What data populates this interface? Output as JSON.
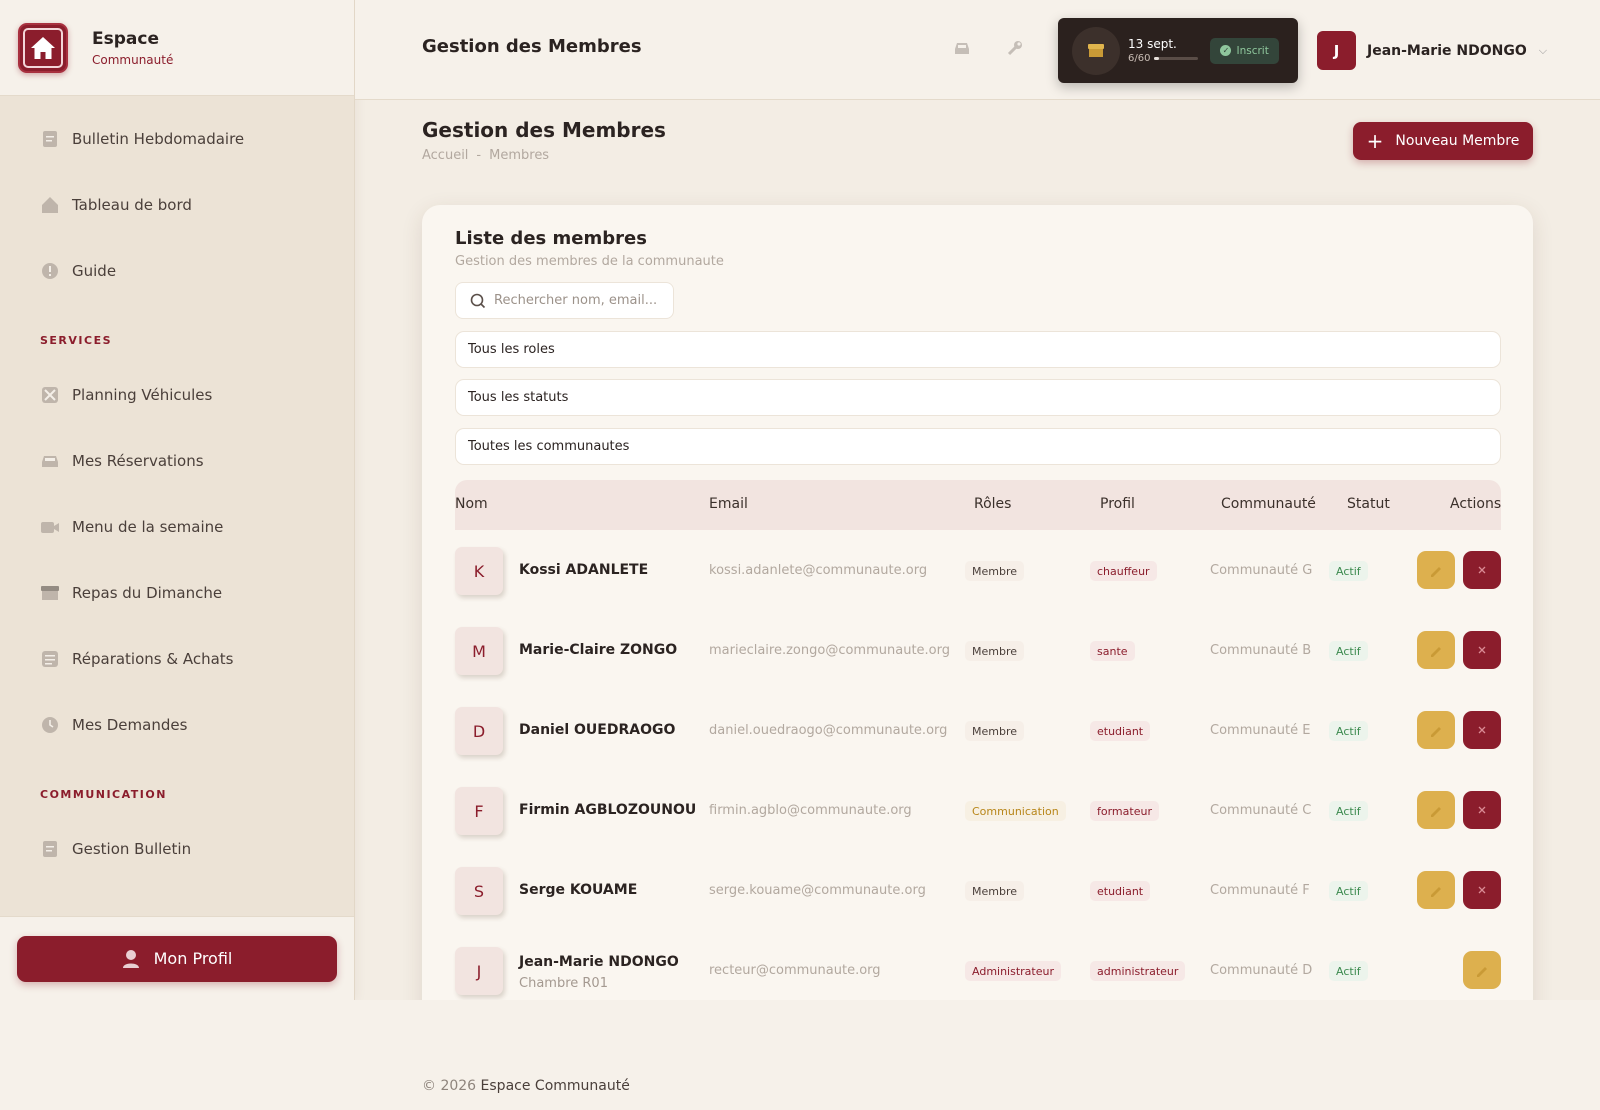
{
  "brand": {
    "title": "Espace",
    "subtitle": "Communauté"
  },
  "sidebar": {
    "items_top": [
      {
        "label": "Bulletin Hebdomadaire",
        "icon": "document-icon"
      },
      {
        "label": "Tableau de bord",
        "icon": "home-icon"
      },
      {
        "label": "Guide",
        "icon": "info-icon"
      }
    ],
    "section_services": "SERVICES",
    "items_services": [
      {
        "label": "Planning Véhicules",
        "icon": "tools-icon"
      },
      {
        "label": "Mes Réservations",
        "icon": "car-icon"
      },
      {
        "label": "Menu de la semaine",
        "icon": "video-icon"
      },
      {
        "label": "Repas du Dimanche",
        "icon": "box-icon"
      },
      {
        "label": "Réparations & Achats",
        "icon": "checklist-icon"
      },
      {
        "label": "Mes Demandes",
        "icon": "clock-icon"
      }
    ],
    "section_communication": "COMMUNICATION",
    "items_communication": [
      {
        "label": "Gestion Bulletin",
        "icon": "document-icon"
      }
    ],
    "profile_button": "Mon Profil"
  },
  "topbar": {
    "title": "Gestion des Membres",
    "status": {
      "date": "13 sept.",
      "count": "6/60",
      "progress": 0.1,
      "badge": "Inscrit"
    },
    "user": {
      "initial": "J",
      "name": "Jean-Marie NDONGO"
    }
  },
  "main": {
    "title": "Gestion des Membres",
    "breadcrumb": {
      "home": "Accueil",
      "sep": "-",
      "current": "Membres"
    },
    "new_button": "Nouveau Membre",
    "card": {
      "title": "Liste des membres",
      "subtitle": "Gestion des membres de la communaute",
      "search_placeholder": "Rechercher nom, email...",
      "filters": [
        "Tous les roles",
        "Tous les statuts",
        "Toutes les communautes"
      ],
      "columns": [
        "Nom",
        "Email",
        "Rôles",
        "Profil",
        "Communauté",
        "Statut",
        "Actions"
      ],
      "rows": [
        {
          "initial": "K",
          "name": "Kossi ADANLETE",
          "sub": "",
          "email": "kossi.adanlete@communaute.org",
          "role": "Membre",
          "profil": "chauffeur",
          "communaute": "Communauté G",
          "statut": "Actif"
        },
        {
          "initial": "M",
          "name": "Marie-Claire ZONGO",
          "sub": "",
          "email": "marieclaire.zongo@communaute.org",
          "role": "Membre",
          "profil": "sante",
          "communaute": "Communauté B",
          "statut": "Actif"
        },
        {
          "initial": "D",
          "name": "Daniel OUEDRAOGO",
          "sub": "",
          "email": "daniel.ouedraogo@communaute.org",
          "role": "Membre",
          "profil": "etudiant",
          "communaute": "Communauté E",
          "statut": "Actif"
        },
        {
          "initial": "F",
          "name": "Firmin AGBLOZOUNOU",
          "sub": "",
          "email": "firmin.agblo@communaute.org",
          "role": "Communication",
          "profil": "formateur",
          "communaute": "Communauté C",
          "statut": "Actif"
        },
        {
          "initial": "S",
          "name": "Serge KOUAME",
          "sub": "",
          "email": "serge.kouame@communaute.org",
          "role": "Membre",
          "profil": "etudiant",
          "communaute": "Communauté F",
          "statut": "Actif"
        },
        {
          "initial": "J",
          "name": "Jean-Marie NDONGO",
          "sub": "Chambre R01",
          "email": "recteur@communaute.org",
          "role": "Administrateur",
          "profil": "administrateur",
          "communaute": "Communauté D",
          "statut": "Actif"
        }
      ]
    }
  },
  "footer": {
    "copyright": "© 2026",
    "name": "Espace Communauté"
  },
  "colors": {
    "primary": "#8b1d2c",
    "accent": "#ddb04e",
    "success": "#3b8a4e"
  }
}
